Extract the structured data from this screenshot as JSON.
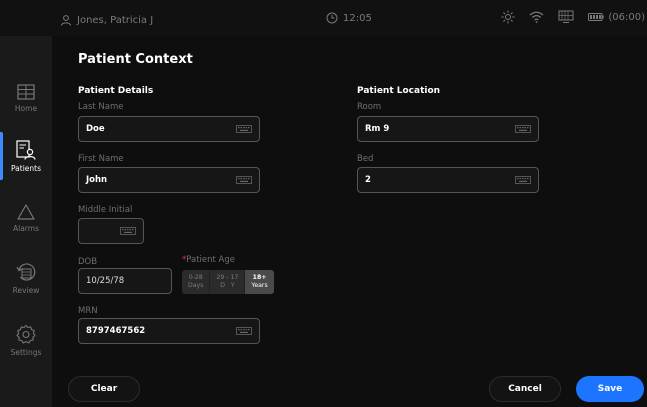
{
  "status_bar": {
    "patient_name": "Jones, Patricia J",
    "time": "12:05",
    "battery": "(06:00)"
  },
  "nav": {
    "items": [
      {
        "label": "Home",
        "icon": "grid-icon",
        "active": false
      },
      {
        "label": "Patients",
        "icon": "patient-list-icon",
        "active": true
      },
      {
        "label": "Alarms",
        "icon": "triangle-alarm-icon",
        "active": false
      },
      {
        "label": "Review",
        "icon": "review-icon",
        "active": false
      },
      {
        "label": "Settings",
        "icon": "gear-icon",
        "active": false
      }
    ]
  },
  "page": {
    "title": "Patient Context",
    "details_title": "Patient Details",
    "location_title": "Patient Location"
  },
  "fields": {
    "last_name": {
      "label": "Last Name",
      "value": "Doe"
    },
    "first_name": {
      "label": "First Name",
      "value": "John"
    },
    "middle_initial": {
      "label": "Middle Initial",
      "value": ""
    },
    "dob": {
      "label": "DOB",
      "value": "10/25/78"
    },
    "mrn": {
      "label": "MRN",
      "value": "8797467562"
    },
    "room": {
      "label": "Room",
      "value": "Rm 9"
    },
    "bed": {
      "label": "Bed",
      "value": "2"
    }
  },
  "patient_age": {
    "required_mark": "*",
    "label": "Patient Age",
    "options": [
      {
        "top": "0-28",
        "bottom": "Days",
        "selected": false
      },
      {
        "top": "29 - 17",
        "bottom": "D   Y",
        "selected": false
      },
      {
        "top": "18+",
        "bottom": "Years",
        "selected": true
      }
    ]
  },
  "buttons": {
    "clear": "Clear",
    "cancel": "Cancel",
    "save": "Save"
  },
  "colors": {
    "accent": "#1d74ff",
    "nav_active": "#3d8bff",
    "required": "#e0383e"
  }
}
